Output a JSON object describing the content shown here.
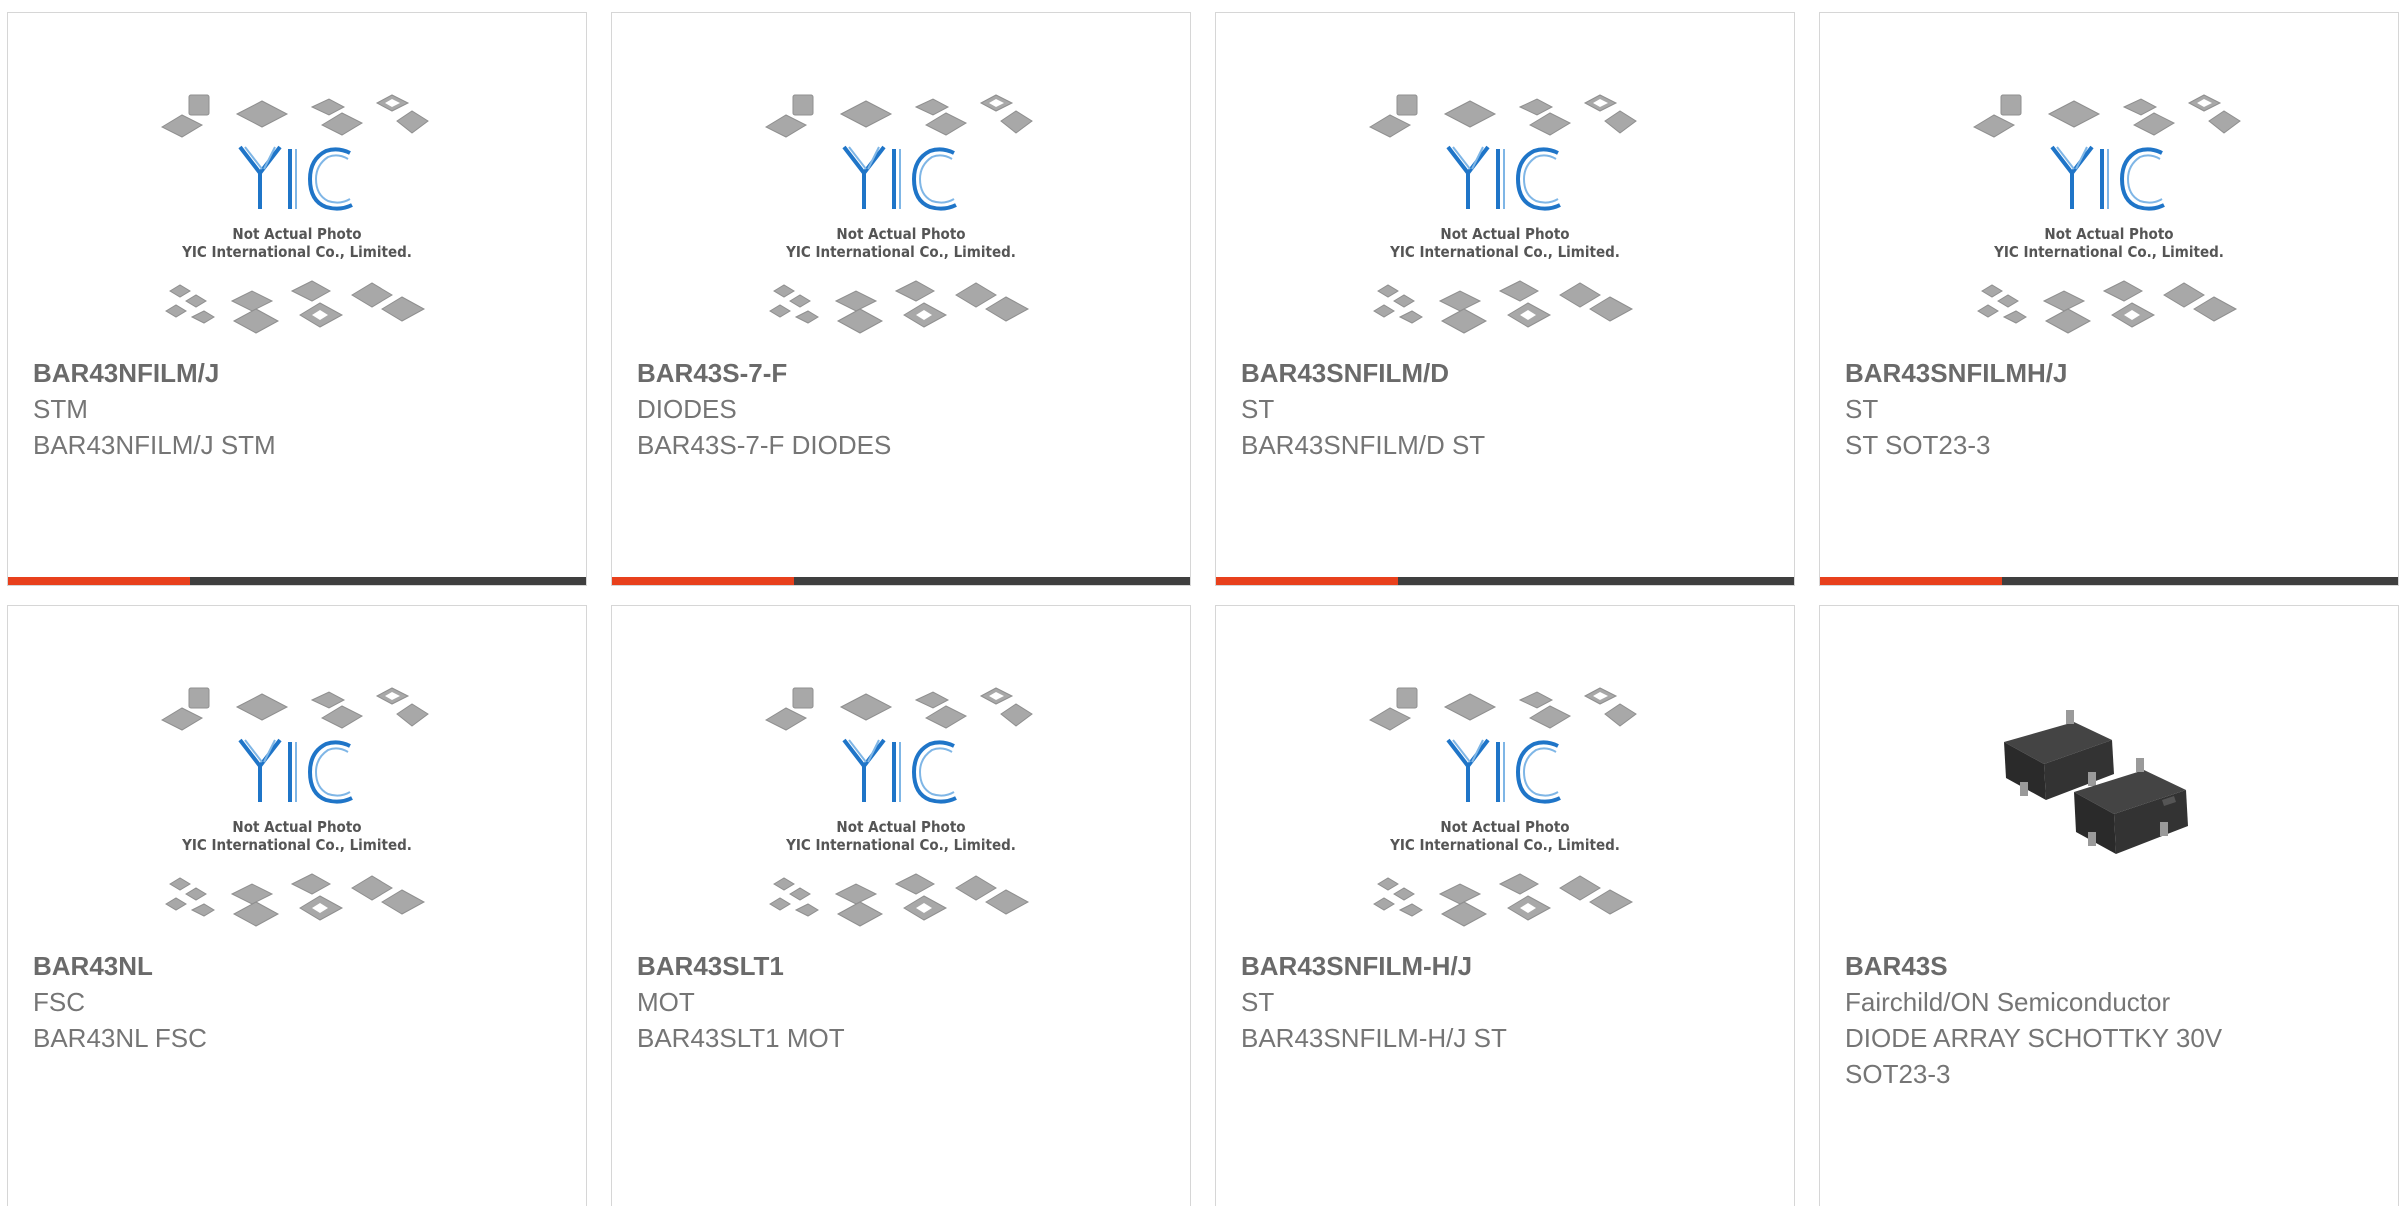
{
  "placeholder": {
    "note_line1": "Not Actual Photo",
    "note_line2": "YIC International Co., Limited."
  },
  "colors": {
    "accent": "#e8401c",
    "bar": "#3f3f3f",
    "logo_blue": "#1f75c8",
    "text": "#6f6f6f"
  },
  "products": [
    {
      "part": "BAR43NFILM/J",
      "brand": "STM",
      "desc": "BAR43NFILM/J STM",
      "image": "placeholder-logo"
    },
    {
      "part": "BAR43S-7-F",
      "brand": "DIODES",
      "desc": "BAR43S-7-F DIODES",
      "image": "placeholder-logo"
    },
    {
      "part": "BAR43SNFILM/D",
      "brand": "ST",
      "desc": "BAR43SNFILM/D ST",
      "image": "placeholder-logo"
    },
    {
      "part": "BAR43SNFILMH/J",
      "brand": "ST",
      "desc": "ST SOT23-3",
      "image": "placeholder-logo"
    },
    {
      "part": "BAR43NL",
      "brand": "FSC",
      "desc": "BAR43NL FSC",
      "image": "placeholder-logo"
    },
    {
      "part": "BAR43SLT1",
      "brand": "MOT",
      "desc": "BAR43SLT1 MOT",
      "image": "placeholder-logo"
    },
    {
      "part": "BAR43SNFILM-H/J",
      "brand": "ST",
      "desc": "BAR43SNFILM-H/J ST",
      "image": "placeholder-logo"
    },
    {
      "part": "BAR43S",
      "brand": "Fairchild/ON Semiconductor",
      "desc": "DIODE ARRAY SCHOTTKY 30V",
      "desc2": "SOT23-3",
      "image": "sot23-package-photo"
    }
  ]
}
